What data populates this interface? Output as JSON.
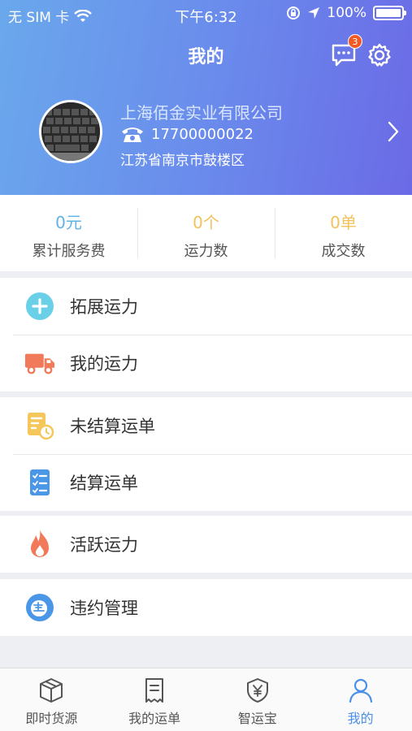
{
  "status_bar": {
    "carrier": "无 SIM 卡",
    "time": "下午6:32",
    "battery": "100%"
  },
  "nav": {
    "title": "我的",
    "message_badge": "3"
  },
  "profile": {
    "company": "上海佰金实业有限公司",
    "phone": "17700000022",
    "address": "江苏省南京市鼓楼区"
  },
  "stats": [
    {
      "value": "0元",
      "label": "累计服务费",
      "color": "#5fb2e8"
    },
    {
      "value": "0个",
      "label": "运力数",
      "color": "#f2c25c"
    },
    {
      "value": "0单",
      "label": "成交数",
      "color": "#f2c25c"
    }
  ],
  "menu": {
    "expand_capacity": "拓展运力",
    "my_capacity": "我的运力",
    "unsettled_orders": "未结算运单",
    "settled_orders": "结算运单",
    "active_capacity": "活跃运力",
    "violation_management": "违约管理"
  },
  "tabs": [
    {
      "label": "即时货源",
      "icon": "box-icon"
    },
    {
      "label": "我的运单",
      "icon": "receipt-icon"
    },
    {
      "label": "智运宝",
      "icon": "shield-yen-icon"
    },
    {
      "label": "我的",
      "icon": "user-icon"
    }
  ],
  "colors": {
    "header_start": "#6aa8ec",
    "header_end": "#6b6ae6",
    "active_tab": "#4a8fe8"
  }
}
